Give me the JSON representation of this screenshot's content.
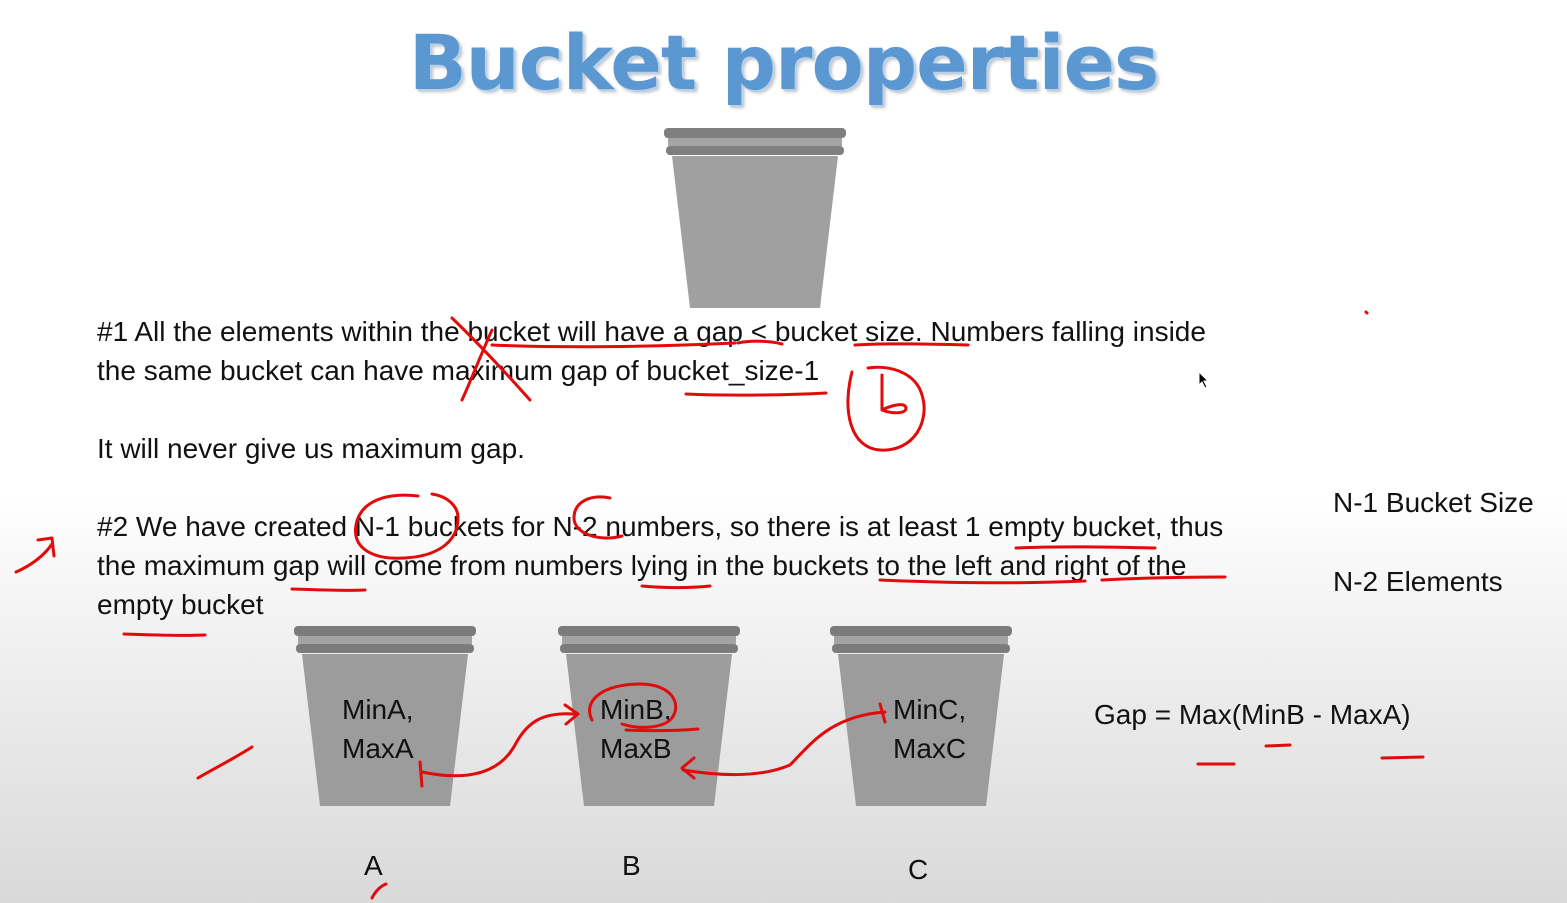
{
  "title": "Bucket properties",
  "paragraph1": {
    "line1": "#1 All the elements within the bucket will have a gap < bucket size. Numbers falling inside",
    "line2": "the same bucket can have maximum gap of bucket_size-1"
  },
  "paragraph2": "It will never give us maximum gap.",
  "paragraph3": {
    "line1": "#2 We have created N-1 buckets for N-2 numbers, so there is at least 1 empty bucket, thus",
    "line2": "the maximum gap will come from numbers lying in the buckets to the left and right of the",
    "line3": "empty bucket"
  },
  "side_notes": {
    "bucket_size": "N-1 Bucket Size",
    "elements": "N-2 Elements"
  },
  "gap_formula": "Gap = Max(MinB  - MaxA)",
  "buckets": [
    {
      "min": "MinA,",
      "max": "MaxA",
      "letter": "A"
    },
    {
      "min": "MinB,",
      "max": "MaxB",
      "letter": "B"
    },
    {
      "min": "MinC,",
      "max": "MaxC",
      "letter": "C"
    }
  ],
  "colors": {
    "title": "#5b97d1",
    "bucket_body": "#9c9c9c",
    "bucket_rim": "#7e7e7e",
    "annotation_ink": "#e10b0b"
  }
}
